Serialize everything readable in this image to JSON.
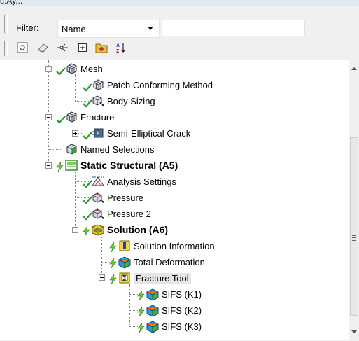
{
  "window_fragment": "c.Ay...",
  "filter": {
    "label": "Filter:",
    "selected": "Name",
    "text_value": ""
  },
  "toolbar": {
    "buttons": [
      {
        "name": "refresh-icon"
      },
      {
        "name": "eraser-icon"
      },
      {
        "name": "branch-icon"
      },
      {
        "name": "expand-all-icon"
      },
      {
        "name": "folder-icon"
      },
      {
        "name": "sort-az-icon"
      }
    ]
  },
  "tree": {
    "items": [
      {
        "label": "Mesh",
        "icon": "mesh-icon",
        "status": "check"
      },
      {
        "label": "Patch Conforming Method",
        "icon": "mesh-method-icon",
        "status": "check"
      },
      {
        "label": "Body Sizing",
        "icon": "sizing-icon",
        "status": "check"
      },
      {
        "label": "Fracture",
        "icon": "mesh-icon",
        "status": "check"
      },
      {
        "label": "Semi-Elliptical Crack",
        "icon": "crack-icon",
        "status": "check"
      },
      {
        "label": "Named Selections",
        "icon": "named-selection-icon",
        "status": "none"
      },
      {
        "label": "Static Structural (A5)",
        "icon": "analysis-icon",
        "status": "bolt"
      },
      {
        "label": "Analysis Settings",
        "icon": "analysis-settings-icon",
        "status": "check"
      },
      {
        "label": "Pressure",
        "icon": "pressure-icon",
        "status": "check"
      },
      {
        "label": "Pressure 2",
        "icon": "pressure-icon",
        "status": "check"
      },
      {
        "label": "Solution (A6)",
        "icon": "solution-icon",
        "status": "bolt"
      },
      {
        "label": "Solution Information",
        "icon": "info-icon",
        "status": "bolt"
      },
      {
        "label": "Total Deformation",
        "icon": "result-icon",
        "status": "bolt"
      },
      {
        "label": "Fracture Tool",
        "icon": "fracture-tool-icon",
        "status": "bolt"
      },
      {
        "label": "SIFS (K1)",
        "icon": "result-icon",
        "status": "bolt"
      },
      {
        "label": "SIFS (K2)",
        "icon": "result-icon",
        "status": "bolt"
      },
      {
        "label": "SIFS (K3)",
        "icon": "result-icon",
        "status": "bolt"
      }
    ]
  }
}
